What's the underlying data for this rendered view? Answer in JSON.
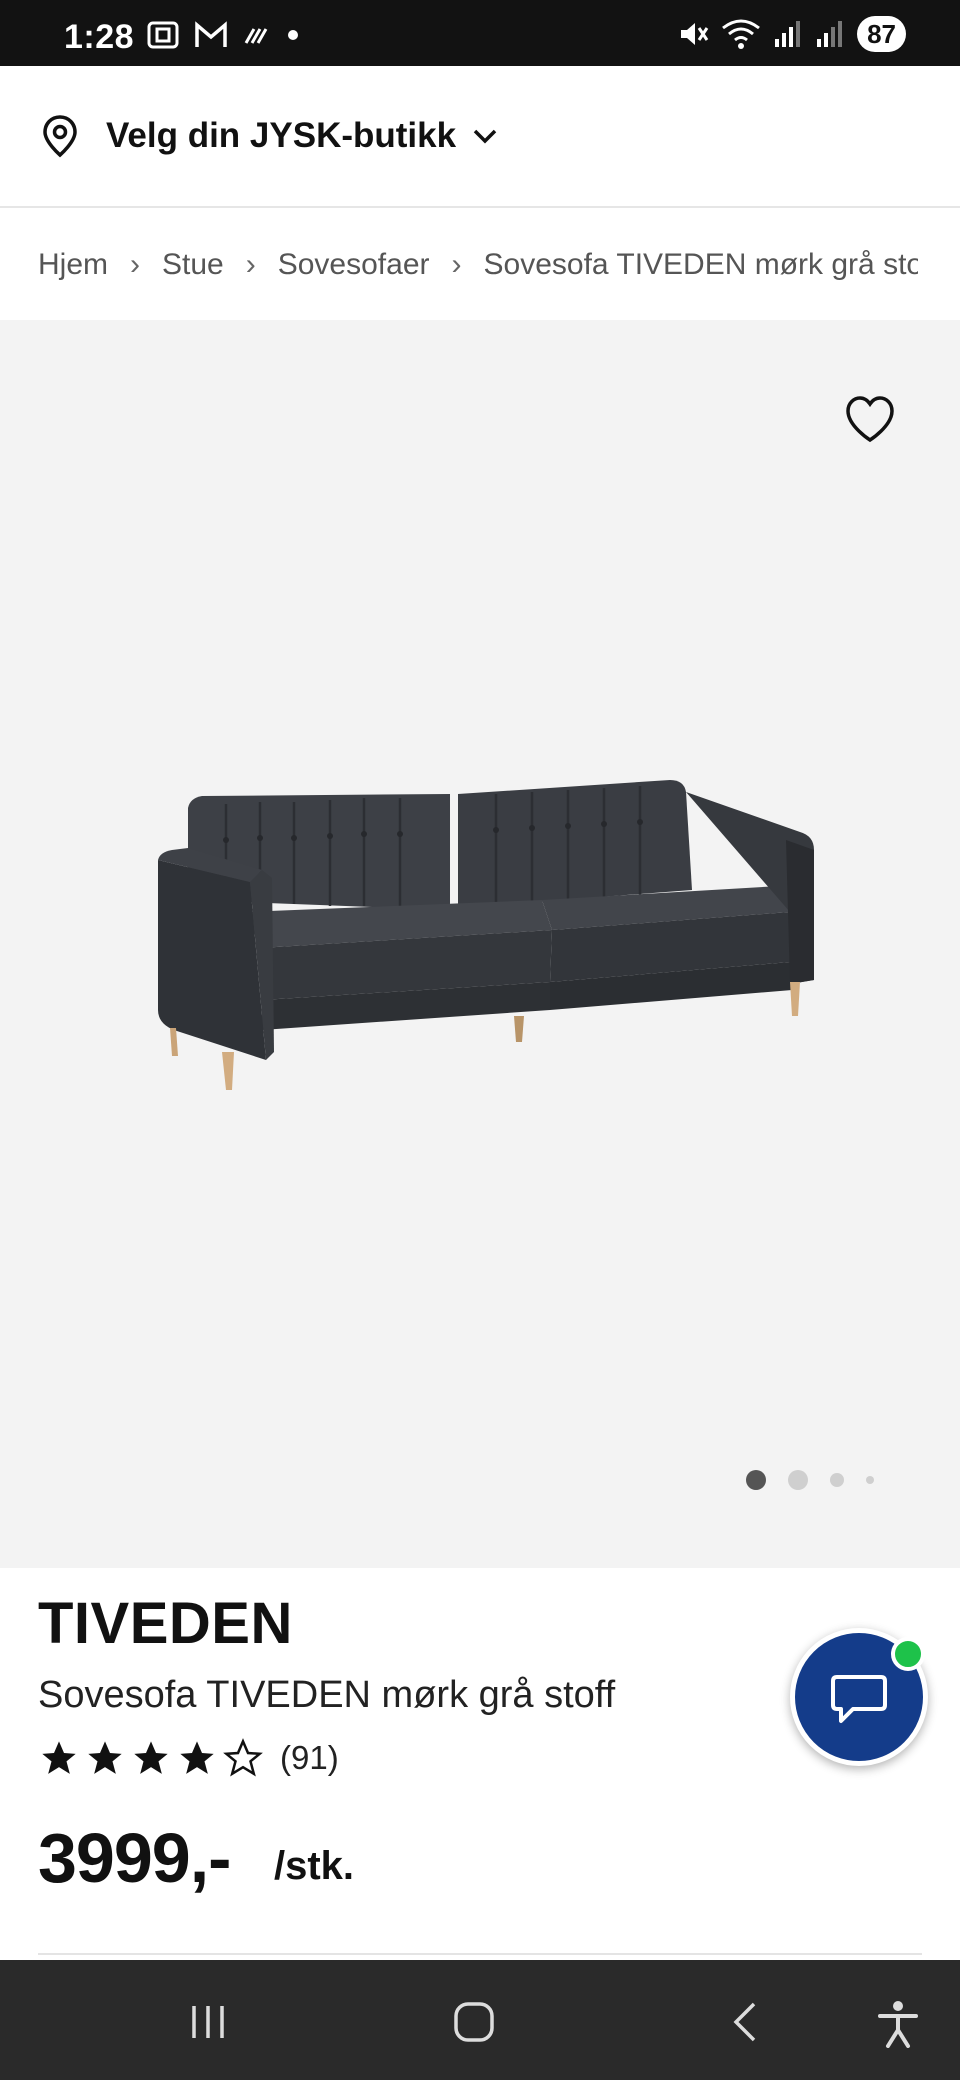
{
  "status_bar": {
    "time": "1:28",
    "battery": "87",
    "icons": [
      "screenshot-icon",
      "gmail-icon",
      "data-saver-icon",
      "dot-icon",
      "mute-icon",
      "wifi-icon",
      "signal-icon"
    ]
  },
  "store": {
    "label": "Velg din JYSK-butikk"
  },
  "breadcrumb": {
    "items": [
      "Hjem",
      "Stue",
      "Sovesofaer",
      "Sovesofa TIVEDEN mørk grå stoff"
    ]
  },
  "gallery": {
    "image_count": 4,
    "active_index": 0
  },
  "product": {
    "title": "TIVEDEN",
    "subtitle": "Sovesofa TIVEDEN mørk grå stoff",
    "rating": 4,
    "rating_max": 5,
    "rating_count": "(91)",
    "price": "3999,-",
    "unit": "/stk."
  },
  "colors": {
    "chat_button": "#143c8a",
    "online": "#1ec24a",
    "sofa": "#3a3d42"
  }
}
